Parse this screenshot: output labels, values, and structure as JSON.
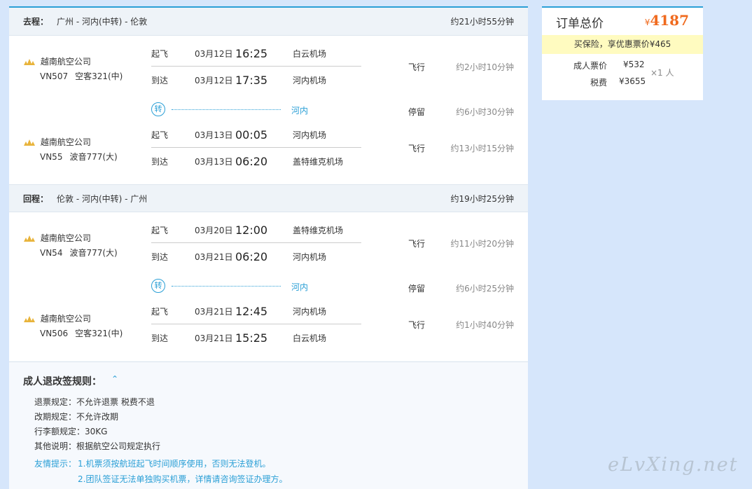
{
  "outbound": {
    "label": "去程：",
    "route": "广州 - 河内(中转) - 伦敦",
    "total": "约21小时55分钟",
    "legs": [
      {
        "airline": "越南航空公司",
        "flight_no": "VN507",
        "aircraft": "空客321(中)",
        "dep_label": "起飞",
        "dep_date": "03月12日",
        "dep_time": "16:25",
        "dep_airport": "白云机场",
        "arr_label": "到达",
        "arr_date": "03月12日",
        "arr_time": "17:35",
        "arr_airport": "河内机场",
        "fly_label": "飞行",
        "duration": "约2小时10分钟"
      },
      {
        "airline": "越南航空公司",
        "flight_no": "VN55",
        "aircraft": "波音777(大)",
        "dep_label": "起飞",
        "dep_date": "03月13日",
        "dep_time": "00:05",
        "dep_airport": "河内机场",
        "arr_label": "到达",
        "arr_date": "03月13日",
        "arr_time": "06:20",
        "arr_airport": "盖特维克机场",
        "fly_label": "飞行",
        "duration": "约13小时15分钟"
      }
    ],
    "transfer": {
      "badge": "转",
      "city": "河内",
      "stop_label": "停留",
      "duration": "约6小时30分钟"
    }
  },
  "return": {
    "label": "回程：",
    "route": "伦敦 - 河内(中转) - 广州",
    "total": "约19小时25分钟",
    "legs": [
      {
        "airline": "越南航空公司",
        "flight_no": "VN54",
        "aircraft": "波音777(大)",
        "dep_label": "起飞",
        "dep_date": "03月20日",
        "dep_time": "12:00",
        "dep_airport": "盖特维克机场",
        "arr_label": "到达",
        "arr_date": "03月21日",
        "arr_time": "06:20",
        "arr_airport": "河内机场",
        "fly_label": "飞行",
        "duration": "约11小时20分钟"
      },
      {
        "airline": "越南航空公司",
        "flight_no": "VN506",
        "aircraft": "空客321(中)",
        "dep_label": "起飞",
        "dep_date": "03月21日",
        "dep_time": "12:45",
        "dep_airport": "河内机场",
        "arr_label": "到达",
        "arr_date": "03月21日",
        "arr_time": "15:25",
        "arr_airport": "白云机场",
        "fly_label": "飞行",
        "duration": "约1小时40分钟"
      }
    ],
    "transfer": {
      "badge": "转",
      "city": "河内",
      "stop_label": "停留",
      "duration": "约6小时25分钟"
    }
  },
  "rules": {
    "title": "成人退改签规则：",
    "toggle": "⌃",
    "items": [
      "退票规定：不允许退票 税费不退",
      "改期规定：不允许改期",
      "行李额规定：30KG",
      "其他说明：根据航空公司规定执行"
    ],
    "tip_label": "友情提示：",
    "tips": [
      "1.机票须按航班起飞时间顺序使用，否则无法登机。",
      "2.团队签证无法单独购买机票，详情请咨询签证办理方。"
    ]
  },
  "order": {
    "title": "订单总价",
    "currency": "¥",
    "total": "4187",
    "promo": "买保险，享优惠票价¥465",
    "adult_label": "成人票价",
    "adult_price": "¥532",
    "tax_label": "税费",
    "tax_price": "¥3655",
    "multiplier": "×1 人"
  },
  "watermark": "eLvXing.net",
  "colors": {
    "accent": "#2a9fd6",
    "price": "#f06a1e",
    "promo_bg": "#fffbc0",
    "page_bg": "#d6e6fb"
  }
}
